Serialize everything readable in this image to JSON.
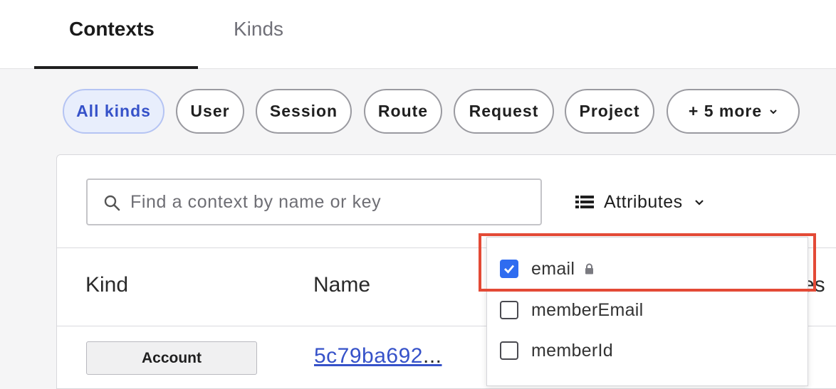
{
  "tabs": [
    {
      "label": "Contexts",
      "active": true
    },
    {
      "label": "Kinds",
      "active": false
    }
  ],
  "filters": {
    "chips": [
      {
        "label": "All kinds",
        "active": true
      },
      {
        "label": "User"
      },
      {
        "label": "Session"
      },
      {
        "label": "Route"
      },
      {
        "label": "Request"
      },
      {
        "label": "Project"
      },
      {
        "label": "+ 5 more",
        "icon": "chevron-down-icon"
      }
    ]
  },
  "search": {
    "placeholder": "Find a context by name or key",
    "value": "",
    "icon": "search-icon"
  },
  "attributes_button": {
    "label": "Attributes",
    "icon": "list-icon",
    "chevron": "chevron-down-icon"
  },
  "table": {
    "columns": [
      "Kind",
      "Name",
      "es"
    ],
    "rows": [
      {
        "kind": "Account",
        "name": "5c79ba692",
        "ellipsis": "..."
      }
    ]
  },
  "attributes_menu": {
    "items": [
      {
        "label": "email",
        "checked": true,
        "locked": true
      },
      {
        "label": "memberEmail",
        "checked": false
      },
      {
        "label": "memberId",
        "checked": false
      }
    ]
  },
  "colors": {
    "accent": "#3652c9",
    "checkbox": "#2f6cf0",
    "highlight": "#e34a36"
  }
}
